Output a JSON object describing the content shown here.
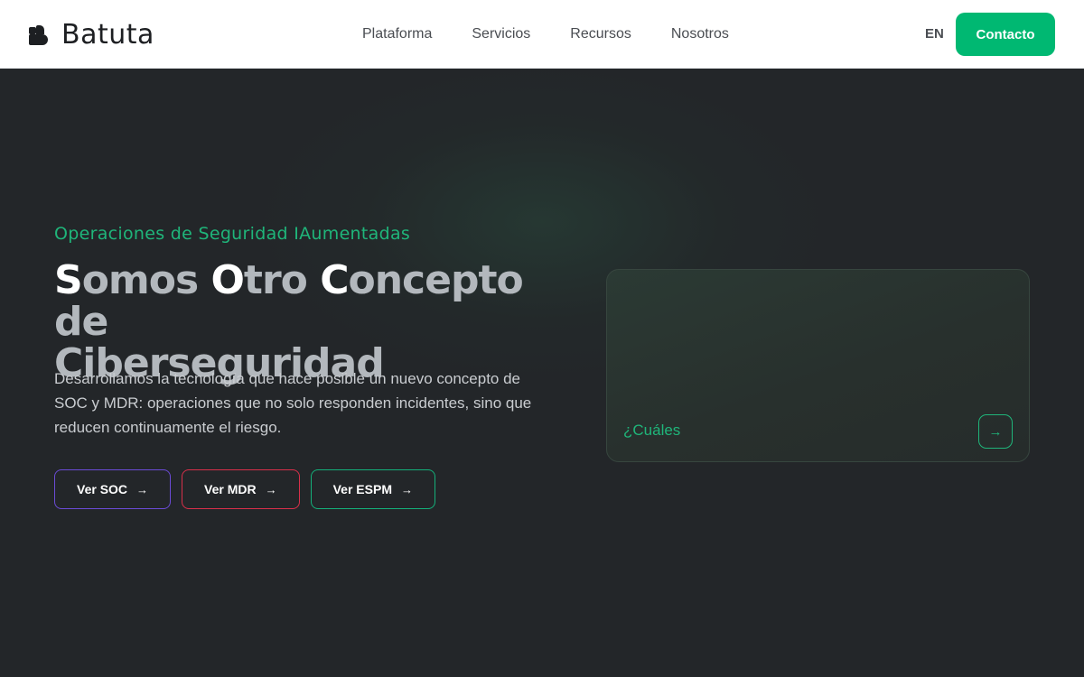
{
  "header": {
    "brand": "Batuta",
    "nav": [
      "Plataforma",
      "Servicios",
      "Recursos",
      "Nosotros"
    ],
    "lang": "EN",
    "contact_label": "Contacto"
  },
  "hero": {
    "eyebrow": "Operaciones de Seguridad IAumentadas",
    "headline": {
      "w1_cap": "S",
      "w1_rest": "omos ",
      "w2_cap": "O",
      "w2_rest": "tro ",
      "w3_cap": "C",
      "w3_rest": "oncepto de",
      "line2": "Ciberseguridad"
    },
    "description": "Desarrollamos la tecnología que hace posible un nuevo concepto de SOC y MDR: operaciones que no solo responden incidentes, sino que reducen continuamente el riesgo.",
    "buttons": {
      "soc": "Ver SOC",
      "mdr": "Ver MDR",
      "espm": "Ver ESPM"
    },
    "card": {
      "label": "¿Cuáles"
    }
  },
  "colors": {
    "accent": "#00b872",
    "background": "#232629",
    "soc_border": "#6b4bd6",
    "mdr_border": "#d8304a",
    "espm_border": "#14b07a"
  }
}
